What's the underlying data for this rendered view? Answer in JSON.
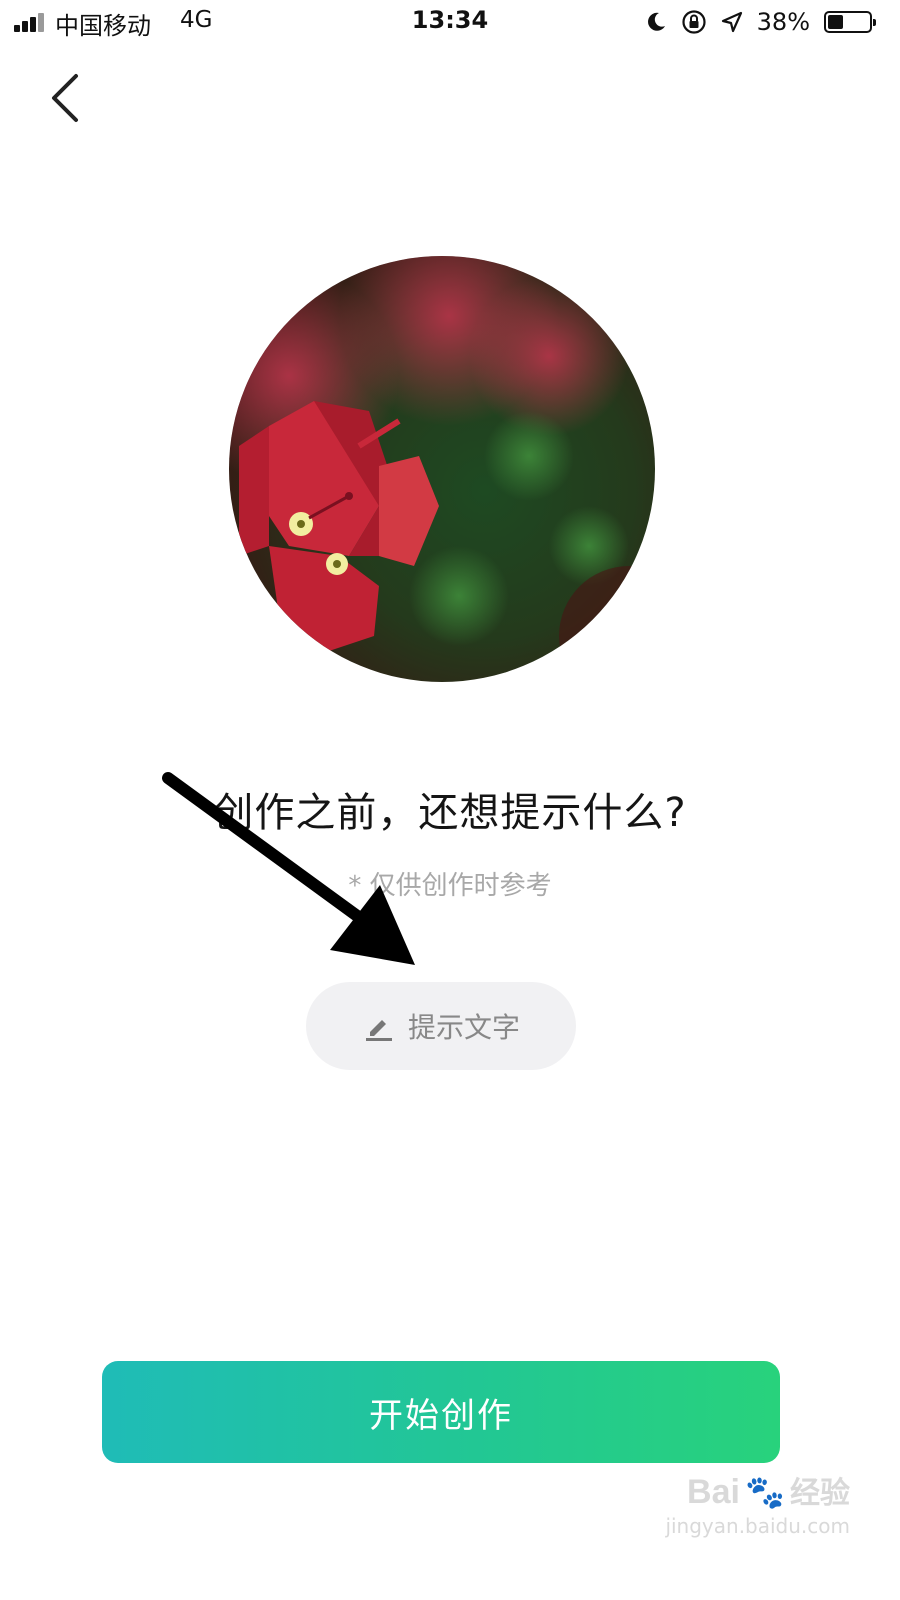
{
  "status_bar": {
    "carrier": "中国移动",
    "network": "4G",
    "time": "13:34",
    "battery_percent": "38%",
    "battery_level": 0.38,
    "icons": [
      "signal-icon",
      "moon-icon",
      "rotation-lock-icon",
      "location-icon",
      "battery-icon"
    ]
  },
  "nav": {
    "back_icon": "chevron-left-icon"
  },
  "main": {
    "cover_image": "red-flower-photo",
    "title": "创作之前，还想提示什么?",
    "subtitle": "* 仅供创作时参考",
    "hint_button": {
      "icon": "pencil-icon",
      "label": "提示文字"
    }
  },
  "footer": {
    "start_button": "开始创作",
    "accent_start": "#1fbcb7",
    "accent_end": "#28d27c"
  },
  "watermark": {
    "brand_left": "Bai",
    "brand_right": "经验",
    "url": "jingyan.baidu.com"
  }
}
